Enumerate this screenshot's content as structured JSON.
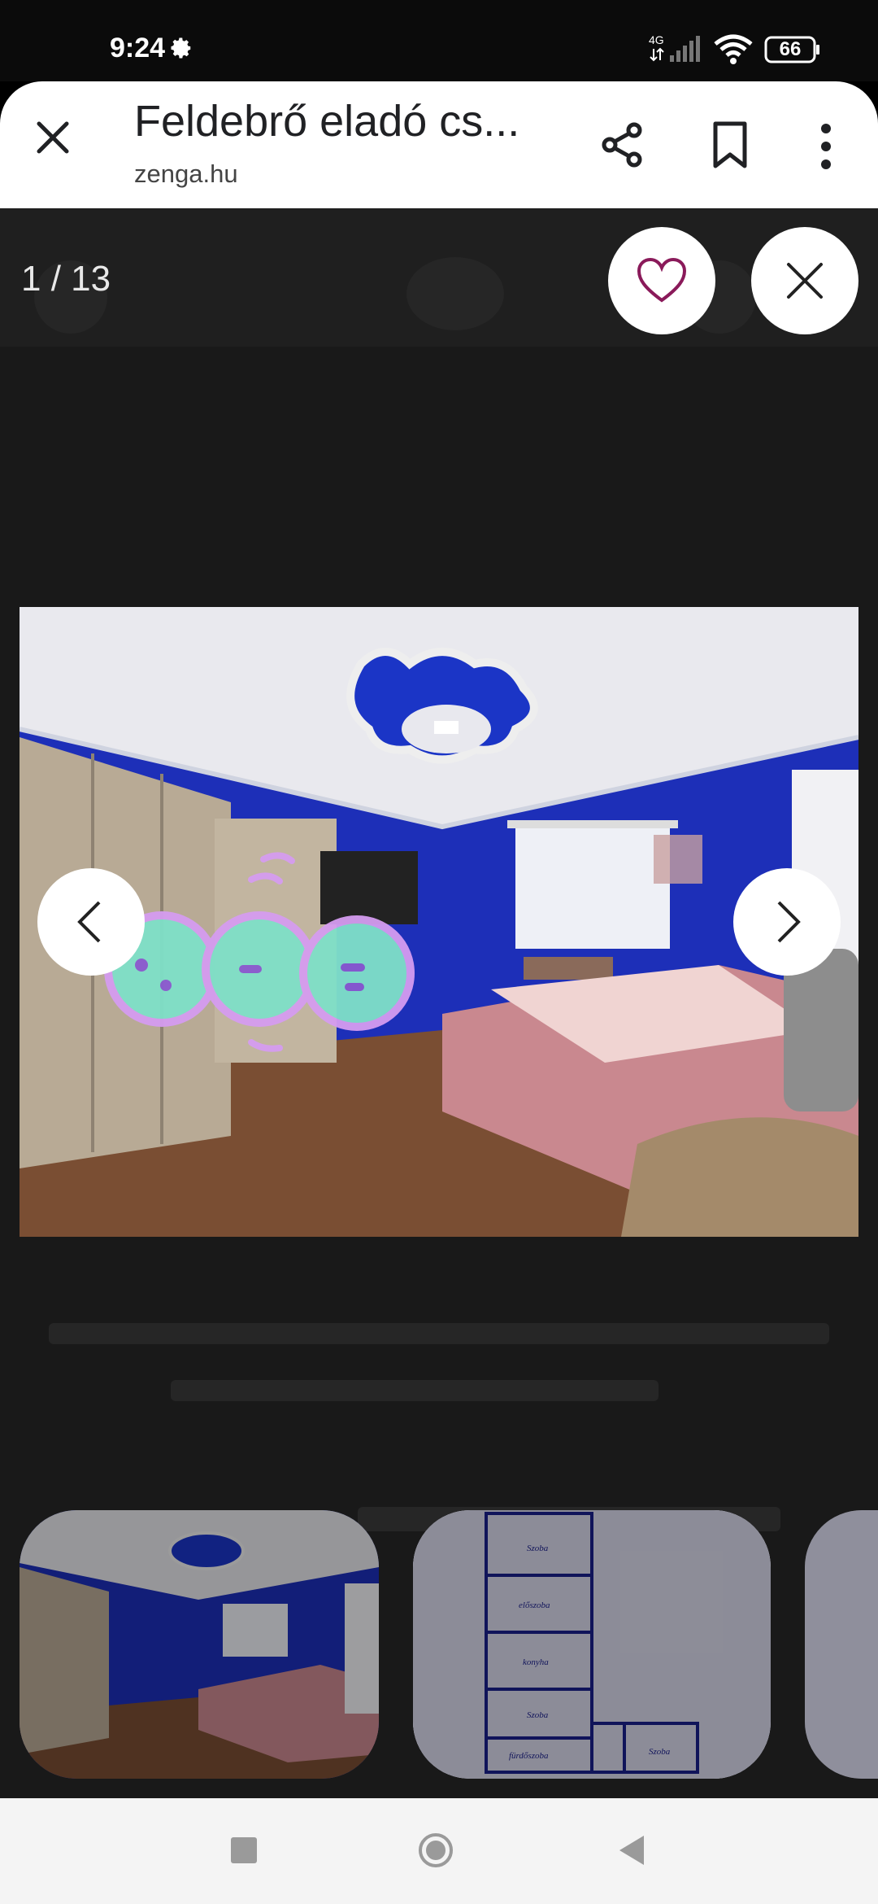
{
  "status_bar": {
    "time": "9:24",
    "network": "4G",
    "battery": "66"
  },
  "toolbar": {
    "title": "Feldebrő eladó cs...",
    "url": "zenga.hu"
  },
  "gallery": {
    "counter": "1 / 13"
  },
  "icons": [
    "settings-icon",
    "signal-icon",
    "wifi-icon",
    "battery-icon",
    "close-icon",
    "share-icon",
    "bookmark-icon",
    "more-vert-icon",
    "heart-icon",
    "close-icon",
    "chevron-left-icon",
    "chevron-right-icon"
  ],
  "colors": {
    "accent": "#8a1a5a",
    "wall_blue": "#1a30c8",
    "overlay_dim": "#191919"
  }
}
